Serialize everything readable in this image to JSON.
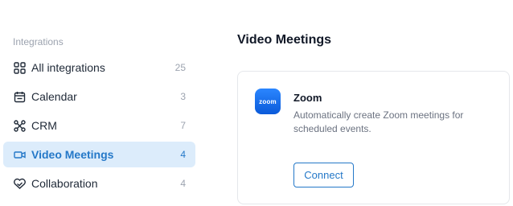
{
  "sidebar": {
    "heading": "Integrations",
    "items": [
      {
        "label": "All integrations",
        "count": "25",
        "icon": "grid-icon",
        "active": false
      },
      {
        "label": "Calendar",
        "count": "3",
        "icon": "calendar-icon",
        "active": false
      },
      {
        "label": "CRM",
        "count": "7",
        "icon": "crm-icon",
        "active": false
      },
      {
        "label": "Video Meetings",
        "count": "4",
        "icon": "video-icon",
        "active": true
      },
      {
        "label": "Collaboration",
        "count": "4",
        "icon": "collaboration-icon",
        "active": false
      }
    ]
  },
  "main": {
    "title": "Video Meetings",
    "card": {
      "logo_text": "zoom",
      "name": "Zoom",
      "description": "Automatically create Zoom meetings for scheduled events.",
      "action_label": "Connect"
    }
  },
  "colors": {
    "accent": "#2478c8",
    "active_bg": "#dcecfb",
    "zoom_brand": "#0b5ad9"
  }
}
